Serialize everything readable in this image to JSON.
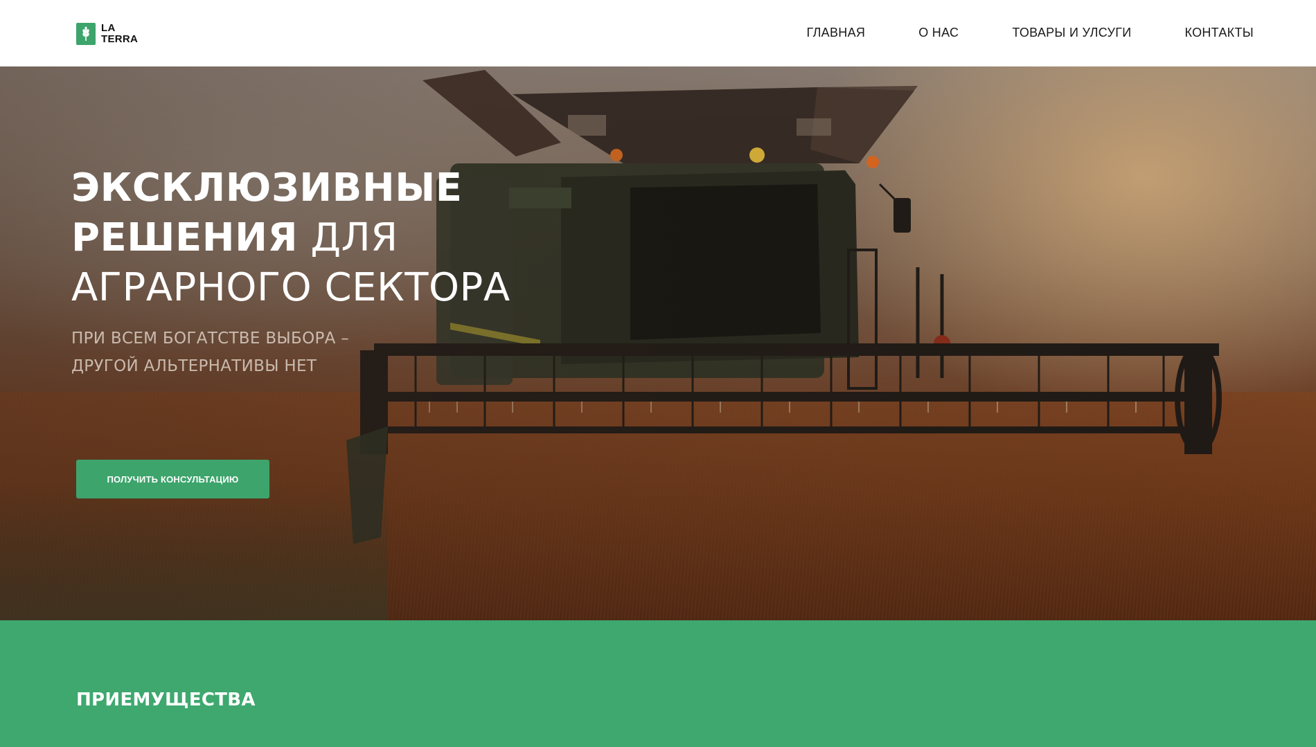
{
  "logo": {
    "line1": "LA",
    "line2": "TERRA",
    "icon": "wheat-icon",
    "color": "#3da46c"
  },
  "nav": {
    "items": [
      {
        "label": "ГЛАВНАЯ"
      },
      {
        "label": "О НАС"
      },
      {
        "label": "ТОВАРЫ И УЛСУГИ"
      },
      {
        "label": "КОНТАКТЫ"
      }
    ]
  },
  "hero": {
    "title_bold_1": "ЭКСКЛЮЗИВНЫЕ",
    "title_bold_2": "РЕШЕНИЯ",
    "title_light_2": " ДЛЯ",
    "title_light_3": "АГРАРНОГО СЕКТОРА",
    "subtitle_1": "ПРИ ВСЕМ БОГАТСТВЕ ВЫБОРА –",
    "subtitle_2": "ДРУГОЙ АЛЬТЕРНАТИВЫ НЕТ",
    "cta_label": "ПОЛУЧИТЬ КОНСУЛЬТАЦИЮ",
    "background_image": "combine-harvester-in-wheat-field"
  },
  "advantages": {
    "title": "ПРИЕМУЩЕСТВА",
    "background_color": "#3ea86f"
  }
}
